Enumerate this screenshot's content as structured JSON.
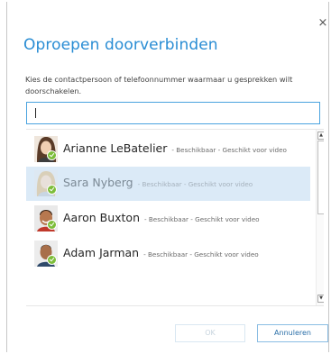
{
  "dialog": {
    "close_glyph": "×",
    "title": "Oproepen doorverbinden",
    "instruction": "Kies de contactpersoon of telefoonnummer waarmaar u gesprekken wilt doorschakelen.",
    "search_value": ""
  },
  "contacts": [
    {
      "name": "Arianne LeBatelier",
      "status": "- Beschikbaar - Geschikt voor video",
      "presence": "available",
      "selected": false
    },
    {
      "name": "Sara Nyberg",
      "status": "- Beschikbaar - Geschikt voor video",
      "presence": "available",
      "selected": true
    },
    {
      "name": "Aaron Buxton",
      "status": "- Beschikbaar - Geschikt voor video",
      "presence": "available",
      "selected": false
    },
    {
      "name": "Adam Jarman",
      "status": "- Beschikbaar - Geschikt voor video",
      "presence": "available",
      "selected": false
    }
  ],
  "buttons": {
    "ok_label": "OK",
    "ok_enabled": false,
    "cancel_label": "Annuleren"
  },
  "scrollbar": {
    "up_glyph": "▲",
    "down_glyph": "▼"
  },
  "colors": {
    "title": "#2a8dd4",
    "selection": "#dbeaf7",
    "presence_available": "#7cbd39",
    "focus_border": "#4aa3df"
  },
  "icons": [
    "close-icon",
    "avatar",
    "presence-available-icon",
    "scroll-up-icon",
    "scroll-down-icon"
  ]
}
